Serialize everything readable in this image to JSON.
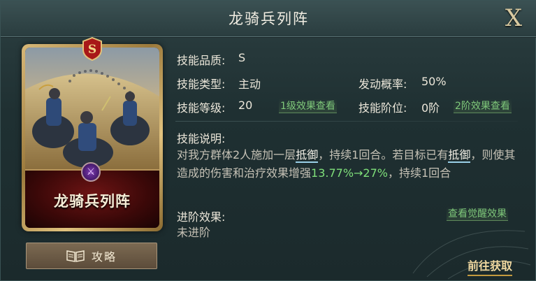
{
  "header": {
    "title": "龙骑兵列阵",
    "close_label": "X"
  },
  "card": {
    "name": "龙骑兵列阵",
    "grade_badge": "S"
  },
  "guide_button": {
    "label": "攻略"
  },
  "skill": {
    "quality_label": "技能品质:",
    "quality_value": "S",
    "type_label": "技能类型:",
    "type_value": "主动",
    "trigger_label": "发动概率:",
    "trigger_value": "50%",
    "level_label": "技能等级:",
    "level_value": "20",
    "level_link": "1级效果查看",
    "stage_label": "技能阶位:",
    "stage_value": "0阶",
    "stage_link": "2阶效果查看",
    "desc_label": "技能说明:",
    "desc": {
      "p1": "对我方群体2人施加一层",
      "kw1": "抵御",
      "p2": "，持续1回合。若目标已有",
      "kw2": "抵御",
      "p3": "，则使其造成的伤害和治疗效果增强",
      "num": "13.77%→27%",
      "p4": "，持续1回合"
    },
    "advance_label": "进阶效果:",
    "advance_link": "查看觉醒效果",
    "advance_value": "未进阶"
  },
  "footer": {
    "goto_label": "前往获取"
  }
}
